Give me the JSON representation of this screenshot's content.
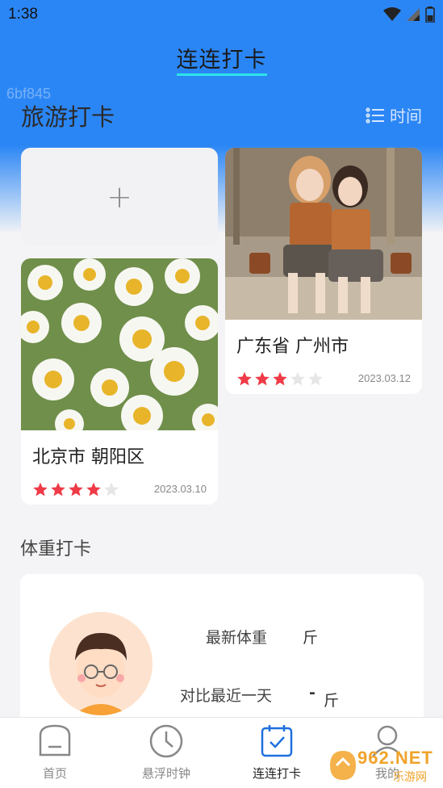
{
  "status_bar": {
    "time": "1:38"
  },
  "header": {
    "title": "连连打卡",
    "code": "6bf845"
  },
  "travel": {
    "title": "旅游打卡",
    "sort_label": "时间",
    "add_symbol": "+",
    "cards": [
      {
        "place": "广东省 广州市",
        "date": "2023.03.12",
        "rating": 3,
        "max_rating": 5
      },
      {
        "place": "北京市 朝阳区",
        "date": "2023.03.10",
        "rating": 4,
        "max_rating": 5
      }
    ]
  },
  "weight": {
    "title": "体重打卡",
    "latest_label": "最新体重",
    "latest_unit": "斤",
    "compare_label": "对比最近一天",
    "compare_value": "-",
    "compare_unit": "斤"
  },
  "tabs": [
    {
      "label": "首页",
      "icon": "home-icon"
    },
    {
      "label": "悬浮时钟",
      "icon": "clock-icon"
    },
    {
      "label": "连连打卡",
      "icon": "calendar-check-icon"
    },
    {
      "label": "我的",
      "icon": "user-icon"
    }
  ],
  "watermark": {
    "brand": "962.NET",
    "sub": "乐游网"
  },
  "colors": {
    "primary": "#2b86f5",
    "star": "#ef3a47",
    "star_empty": "#e6e6e6",
    "underline": "#2ee3e8"
  }
}
